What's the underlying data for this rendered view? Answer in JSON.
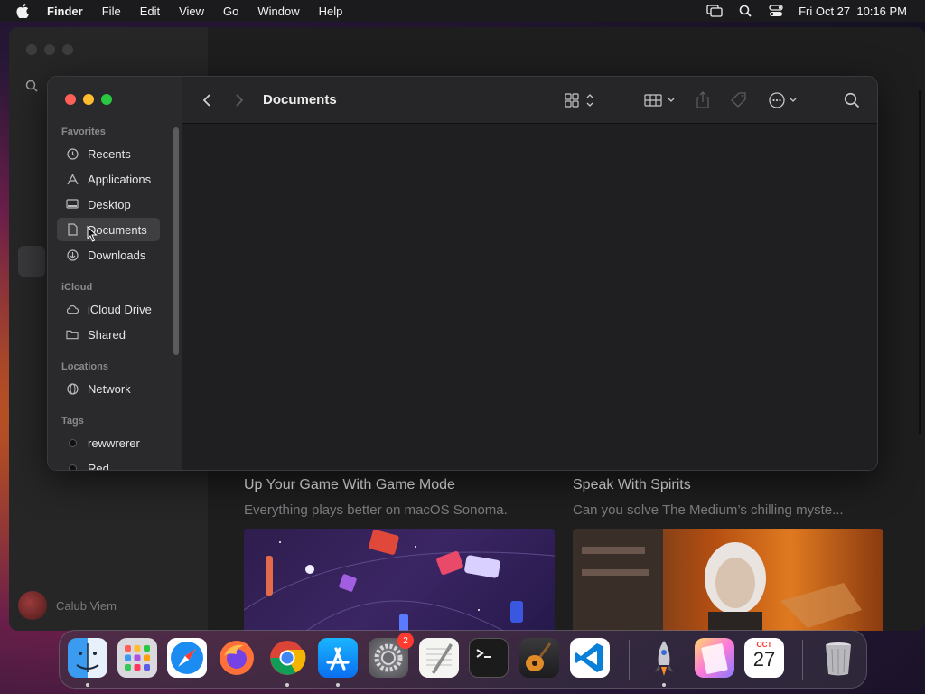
{
  "menubar": {
    "items": [
      "Finder",
      "File",
      "Edit",
      "View",
      "Go",
      "Window",
      "Help"
    ],
    "datetime": "Fri Oct 27  10:16 PM",
    "status_icons": [
      "screen-mirroring-icon",
      "spotlight-search-icon",
      "control-center-icon"
    ]
  },
  "background_window": {
    "app": "App Store",
    "user_name": "Calub Viem",
    "cards": [
      {
        "title": "Up Your Game With Game Mode",
        "subtitle": "Everything plays better on macOS Sonoma."
      },
      {
        "title": "Speak With Spirits",
        "subtitle": "Can you solve The Medium’s chilling myste..."
      }
    ]
  },
  "finder": {
    "title": "Documents",
    "sidebar": {
      "sections": [
        {
          "label": "Favorites",
          "items": [
            {
              "label": "Recents",
              "icon": "clock-icon"
            },
            {
              "label": "Applications",
              "icon": "applications-icon"
            },
            {
              "label": "Desktop",
              "icon": "desktop-icon"
            },
            {
              "label": "Documents",
              "icon": "document-icon",
              "selected": true
            },
            {
              "label": "Downloads",
              "icon": "download-icon"
            }
          ]
        },
        {
          "label": "iCloud",
          "items": [
            {
              "label": "iCloud Drive",
              "icon": "cloud-icon"
            },
            {
              "label": "Shared",
              "icon": "shared-folder-icon"
            }
          ]
        },
        {
          "label": "Locations",
          "items": [
            {
              "label": "Network",
              "icon": "globe-icon"
            }
          ]
        },
        {
          "label": "Tags",
          "items": [
            {
              "label": "rewwrerer",
              "icon": "tag-dot-icon",
              "color": "#111111"
            },
            {
              "label": "Red",
              "icon": "tag-dot-icon",
              "color": "#ff453a"
            }
          ]
        }
      ]
    },
    "toolbar_icons": [
      "back-icon",
      "forward-icon",
      "icon-view-icon",
      "group-icon",
      "share-icon",
      "tag-icon",
      "more-actions-icon",
      "search-icon"
    ]
  },
  "dock": {
    "apps": [
      {
        "name": "Finder",
        "running": true
      },
      {
        "name": "Launchpad",
        "running": false
      },
      {
        "name": "Safari",
        "running": false
      },
      {
        "name": "Firefox",
        "running": false
      },
      {
        "name": "Chrome",
        "running": true
      },
      {
        "name": "App Store",
        "running": true
      },
      {
        "name": "System Settings",
        "running": false,
        "badge": "2"
      },
      {
        "name": "TextEdit",
        "running": false
      },
      {
        "name": "Terminal",
        "running": false
      },
      {
        "name": "GarageBand",
        "running": false
      },
      {
        "name": "Visual Studio Code",
        "running": false
      },
      {
        "name": "Rocket Typist",
        "running": true
      },
      {
        "name": "Pages",
        "running": false
      },
      {
        "name": "Calendar",
        "running": false,
        "month": "OCT",
        "day": "27"
      },
      {
        "name": "Trash",
        "running": false
      }
    ]
  },
  "colors": {
    "traffic_red": "#ff5f57",
    "traffic_yellow": "#febc2e",
    "traffic_green": "#28c840",
    "selection": "#3f3f41"
  }
}
